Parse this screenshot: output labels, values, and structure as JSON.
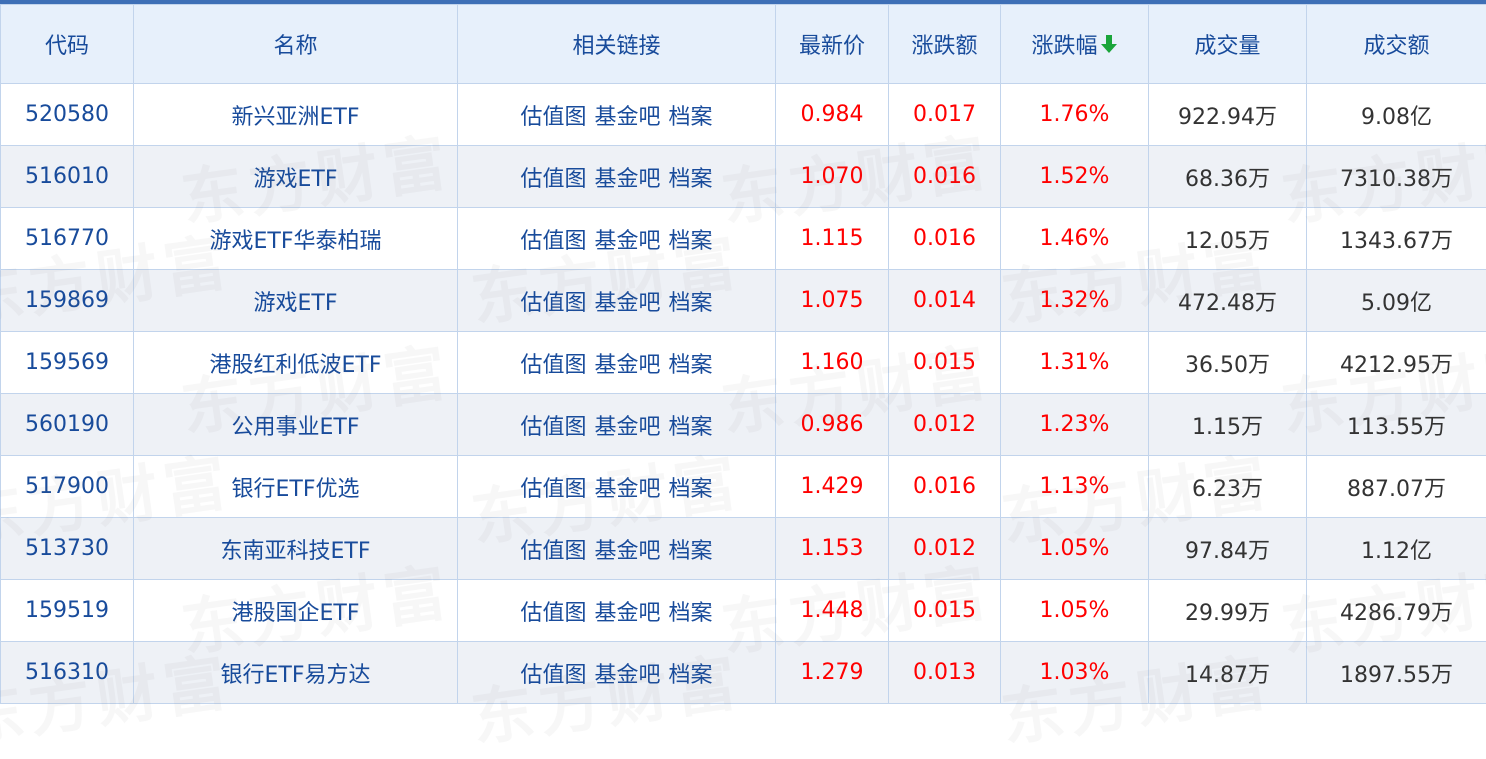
{
  "columns": [
    {
      "key": "code",
      "label": "代码"
    },
    {
      "key": "name",
      "label": "名称"
    },
    {
      "key": "links",
      "label": "相关链接"
    },
    {
      "key": "price",
      "label": "最新价"
    },
    {
      "key": "change",
      "label": "涨跌额"
    },
    {
      "key": "pct",
      "label": "涨跌幅"
    },
    {
      "key": "volume",
      "label": "成交量"
    },
    {
      "key": "amount",
      "label": "成交额"
    }
  ],
  "sort": {
    "column": "pct",
    "direction": "down",
    "icon": "arrow-down-icon",
    "color": "#1aa53a"
  },
  "link_labels": [
    "估值图",
    "基金吧",
    "档案"
  ],
  "watermark": "东方财富",
  "colors": {
    "header_bg": "#e7f0fb",
    "link": "#184b9b",
    "up": "#ff0000",
    "row_alt": "#eef1f6"
  },
  "rows": [
    {
      "code": "520580",
      "name": "新兴亚洲ETF",
      "price": "0.984",
      "change": "0.017",
      "pct": "1.76%",
      "volume": "922.94万",
      "amount": "9.08亿"
    },
    {
      "code": "516010",
      "name": "游戏ETF",
      "price": "1.070",
      "change": "0.016",
      "pct": "1.52%",
      "volume": "68.36万",
      "amount": "7310.38万"
    },
    {
      "code": "516770",
      "name": "游戏ETF华泰柏瑞",
      "price": "1.115",
      "change": "0.016",
      "pct": "1.46%",
      "volume": "12.05万",
      "amount": "1343.67万"
    },
    {
      "code": "159869",
      "name": "游戏ETF",
      "price": "1.075",
      "change": "0.014",
      "pct": "1.32%",
      "volume": "472.48万",
      "amount": "5.09亿"
    },
    {
      "code": "159569",
      "name": "港股红利低波ETF",
      "price": "1.160",
      "change": "0.015",
      "pct": "1.31%",
      "volume": "36.50万",
      "amount": "4212.95万"
    },
    {
      "code": "560190",
      "name": "公用事业ETF",
      "price": "0.986",
      "change": "0.012",
      "pct": "1.23%",
      "volume": "1.15万",
      "amount": "113.55万"
    },
    {
      "code": "517900",
      "name": "银行ETF优选",
      "price": "1.429",
      "change": "0.016",
      "pct": "1.13%",
      "volume": "6.23万",
      "amount": "887.07万"
    },
    {
      "code": "513730",
      "name": "东南亚科技ETF",
      "price": "1.153",
      "change": "0.012",
      "pct": "1.05%",
      "volume": "97.84万",
      "amount": "1.12亿"
    },
    {
      "code": "159519",
      "name": "港股国企ETF",
      "price": "1.448",
      "change": "0.015",
      "pct": "1.05%",
      "volume": "29.99万",
      "amount": "4286.79万"
    },
    {
      "code": "516310",
      "name": "银行ETF易方达",
      "price": "1.279",
      "change": "0.013",
      "pct": "1.03%",
      "volume": "14.87万",
      "amount": "1897.55万"
    }
  ]
}
